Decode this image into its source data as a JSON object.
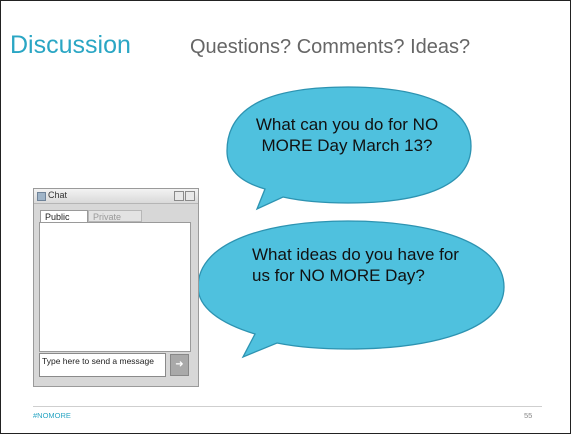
{
  "slide": {
    "title": "Discussion",
    "subtitle": "Questions? Comments? Ideas?",
    "bubble_color": "#4fc1de",
    "accent_color": "#2aa6c4",
    "bubbles": [
      {
        "text": "What can you do for NO MORE Day March 13?"
      },
      {
        "text": "What ideas do you have for us for NO MORE Day?"
      }
    ],
    "footer": {
      "hashtag": "#NOMORE",
      "page_number": "55"
    }
  },
  "chat": {
    "title": "Chat",
    "tabs": [
      "Public",
      "Private"
    ],
    "input_placeholder": "Type here to send a message",
    "send_icon": "arrow-right-icon"
  }
}
